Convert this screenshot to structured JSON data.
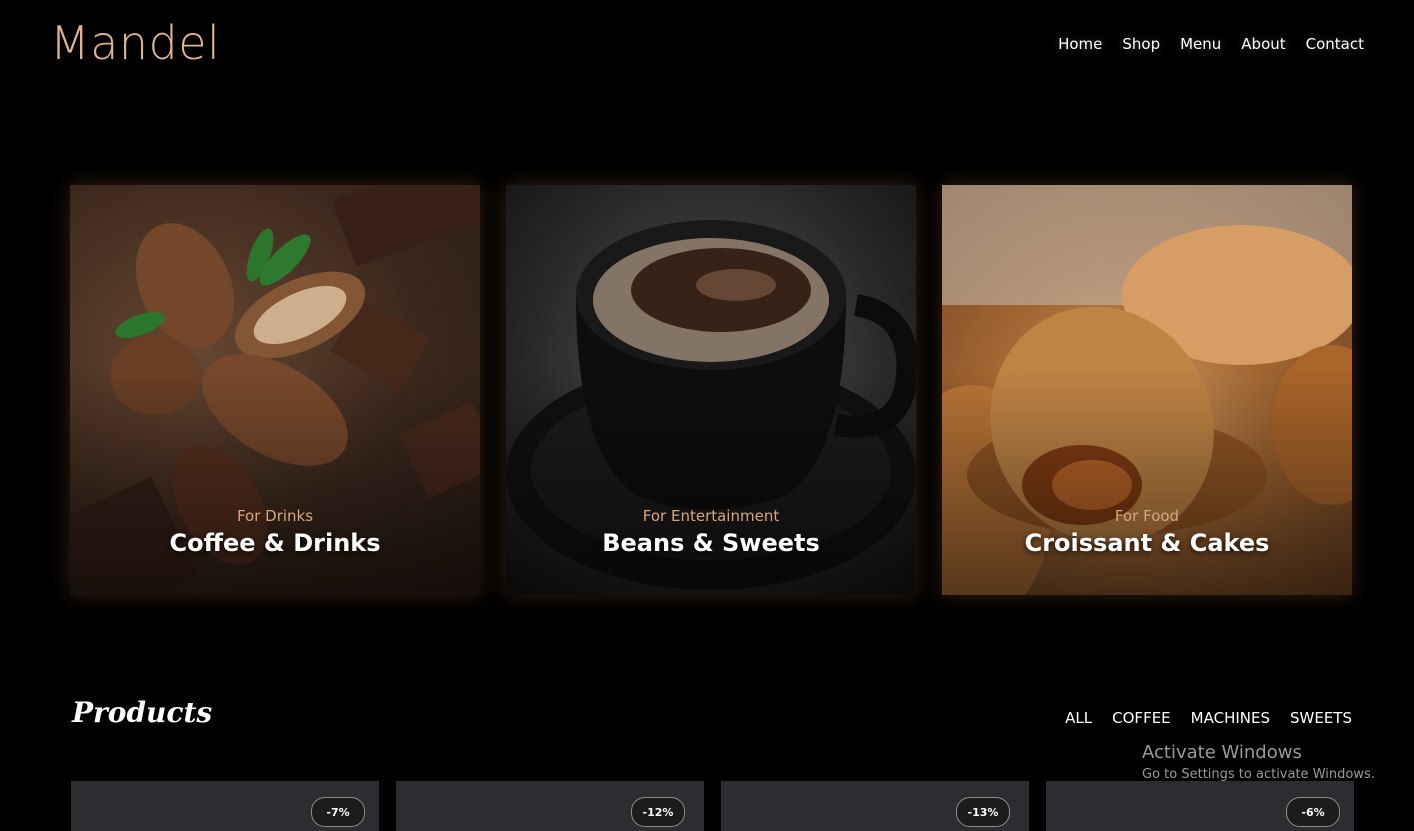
{
  "brand": "Mandel",
  "nav": [
    "Home",
    "Shop",
    "Menu",
    "About",
    "Contact"
  ],
  "categories": [
    {
      "subtitle": "For Drinks",
      "title": "Coffee & Drinks"
    },
    {
      "subtitle": "For Entertainment",
      "title": "Beans & Sweets"
    },
    {
      "subtitle": "For Food",
      "title": "Croissant & Cakes"
    }
  ],
  "products": {
    "heading": "Products",
    "filters": [
      "ALL",
      "COFFEE",
      "MACHINES",
      "SWEETS"
    ],
    "items": [
      {
        "discount": "-7%"
      },
      {
        "discount": "-12%"
      },
      {
        "discount": "-13%"
      },
      {
        "discount": "-6%"
      }
    ]
  },
  "watermark": {
    "line1": "Activate Windows",
    "line2": "Go to Settings to activate Windows."
  },
  "colors": {
    "accent": "#e2b48f",
    "background": "#000000"
  }
}
